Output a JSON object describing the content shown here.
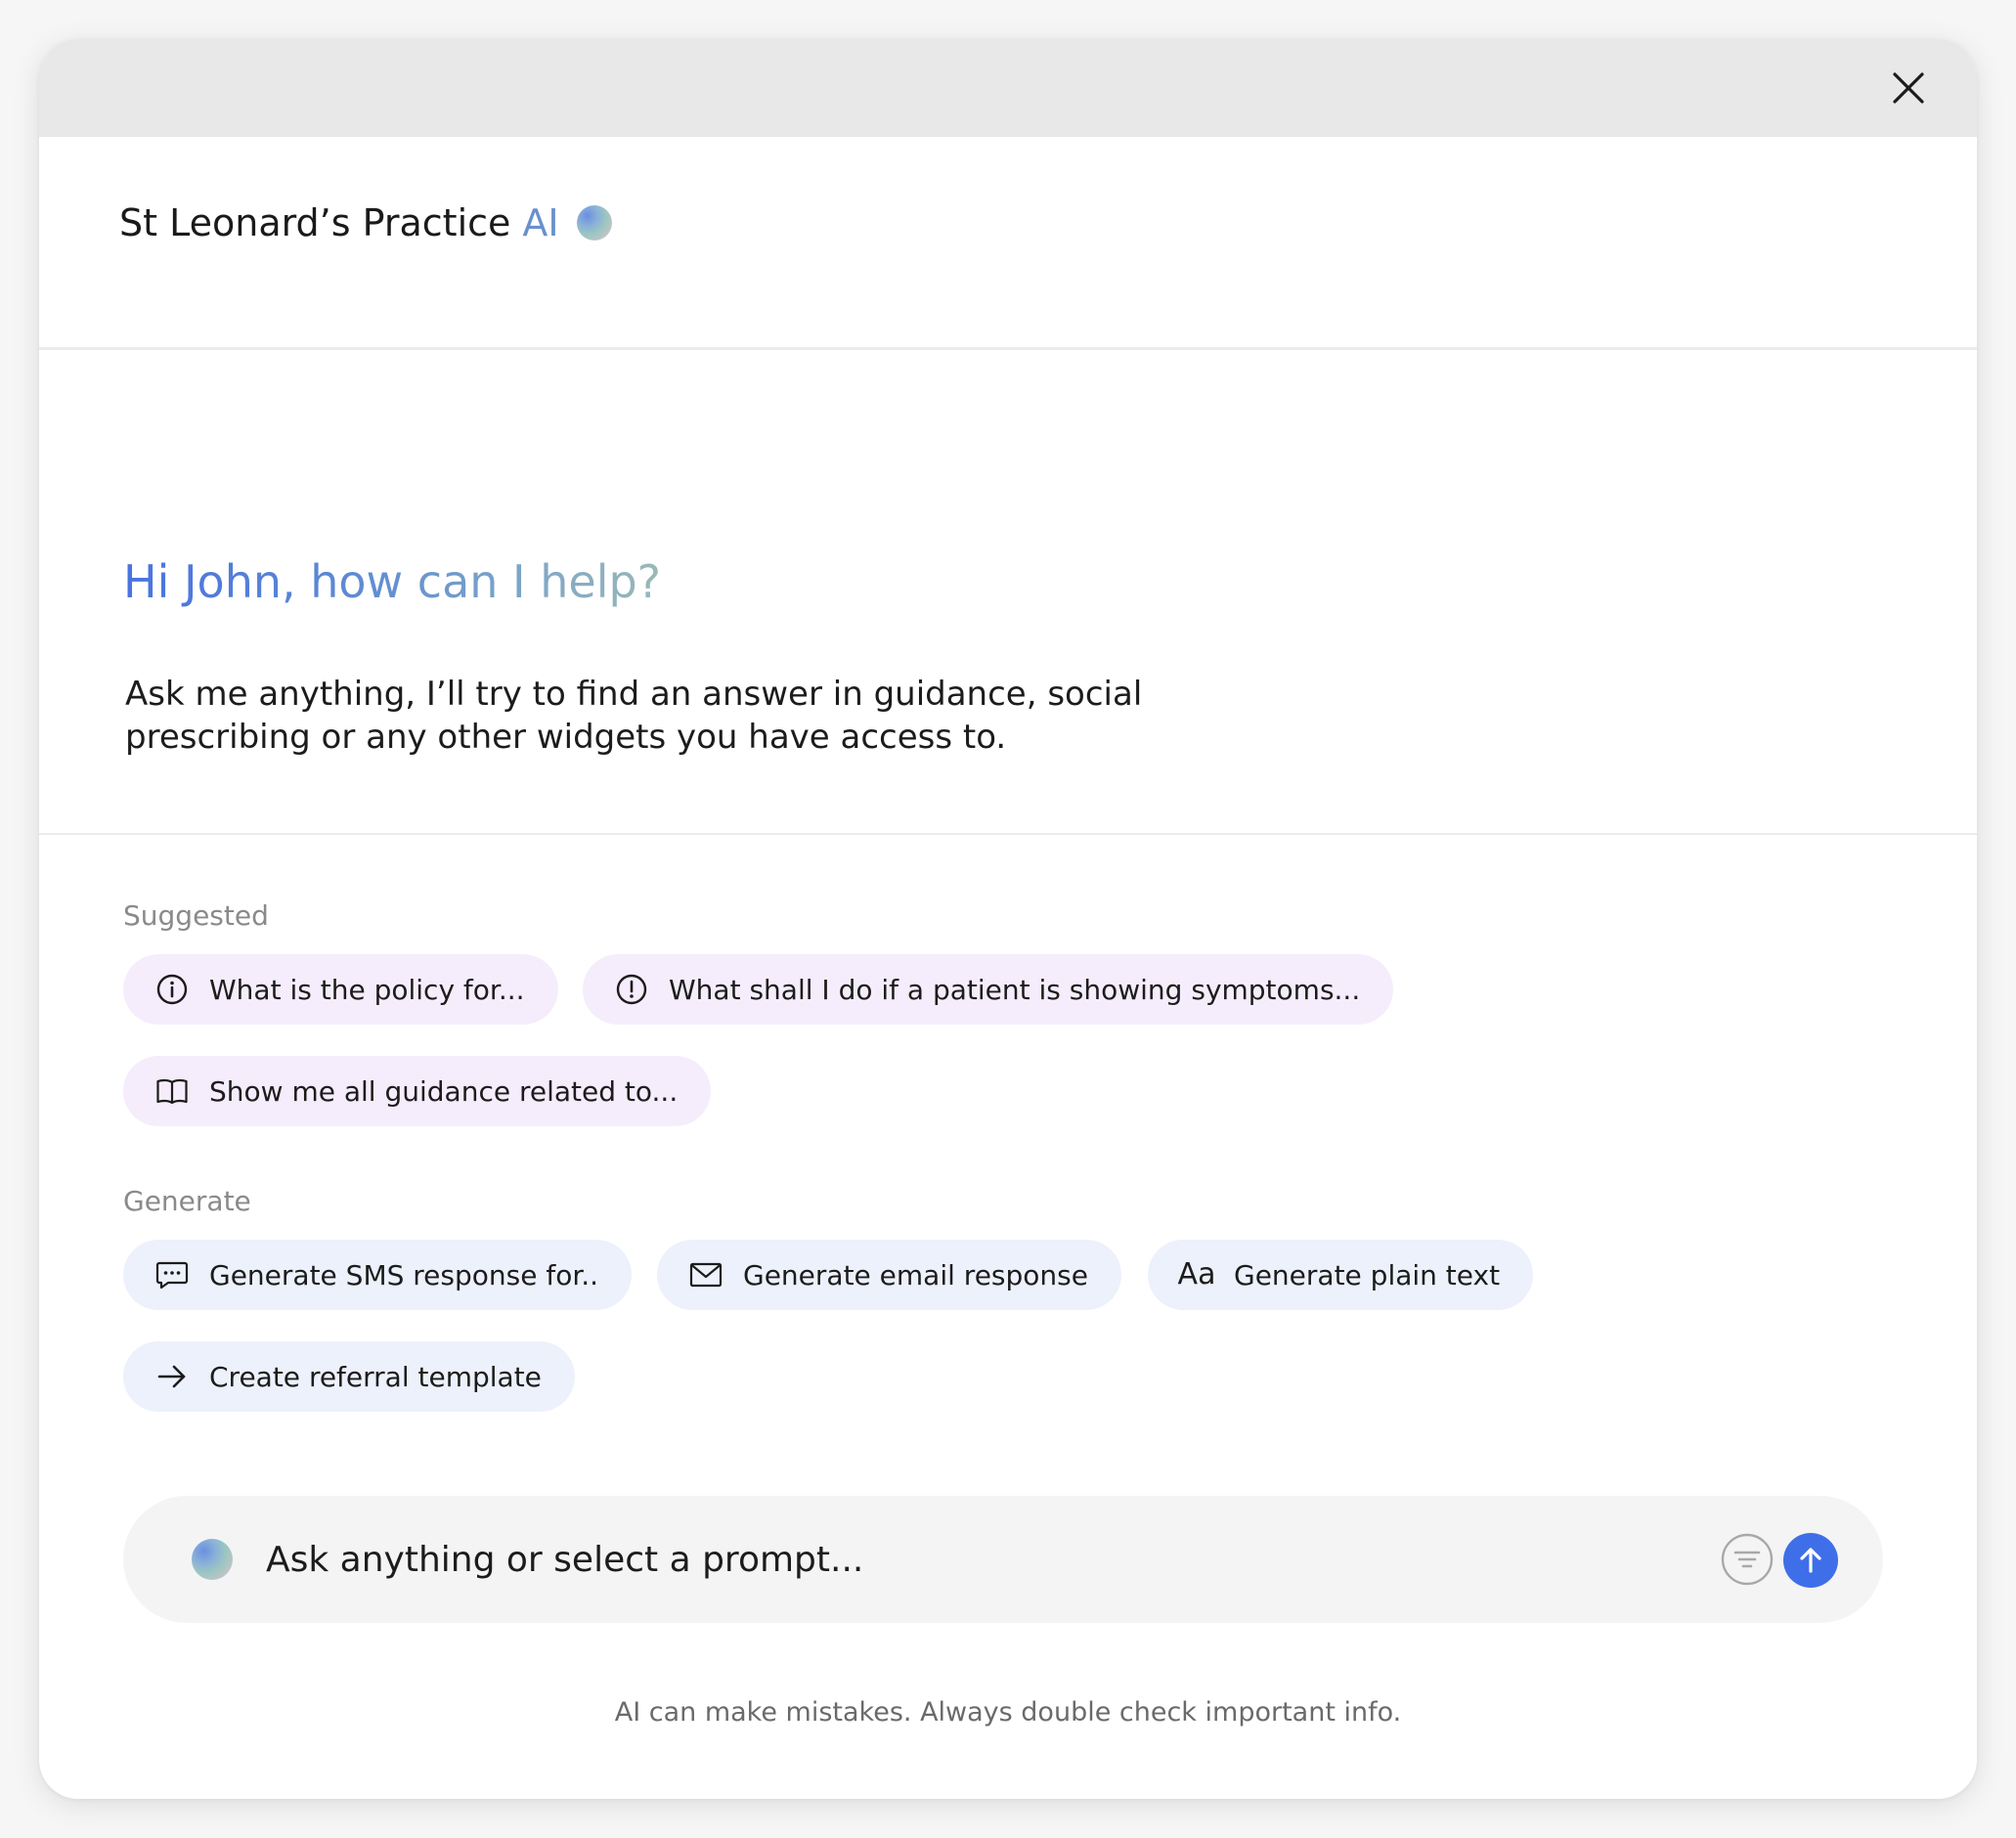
{
  "header": {
    "title": "St Leonard’s Practice",
    "ai_label": "AI"
  },
  "welcome": {
    "greeting": "Hi John, how can I help?",
    "intro": "Ask me anything, I’ll try to find an answer in guidance, social prescribing or any other widgets you have access to."
  },
  "suggested": {
    "label": "Suggested",
    "items": [
      {
        "label": "What is the policy for...",
        "icon": "info-icon"
      },
      {
        "label": "What shall I do if a patient is showing symptoms...",
        "icon": "alert-icon"
      },
      {
        "label": "Show me all guidance related to...",
        "icon": "book-icon"
      }
    ]
  },
  "generate": {
    "label": "Generate",
    "items": [
      {
        "label": "Generate SMS response for..",
        "icon": "chat-icon"
      },
      {
        "label": "Generate email response",
        "icon": "mail-icon"
      },
      {
        "label": "Generate plain text",
        "icon": "text-icon",
        "glyph": "Aa"
      },
      {
        "label": "Create referral template",
        "icon": "arrow-right-icon"
      }
    ]
  },
  "input": {
    "placeholder": "Ask anything or select a prompt..."
  },
  "footer": {
    "disclaimer": "AI can make mistakes. Always double check important info."
  },
  "colors": {
    "accent": "#3f6fe8",
    "suggested_chip_bg": "#f5edfb",
    "generate_chip_bg": "#edf1fb",
    "titlebar_bg": "#e8e8e8"
  }
}
